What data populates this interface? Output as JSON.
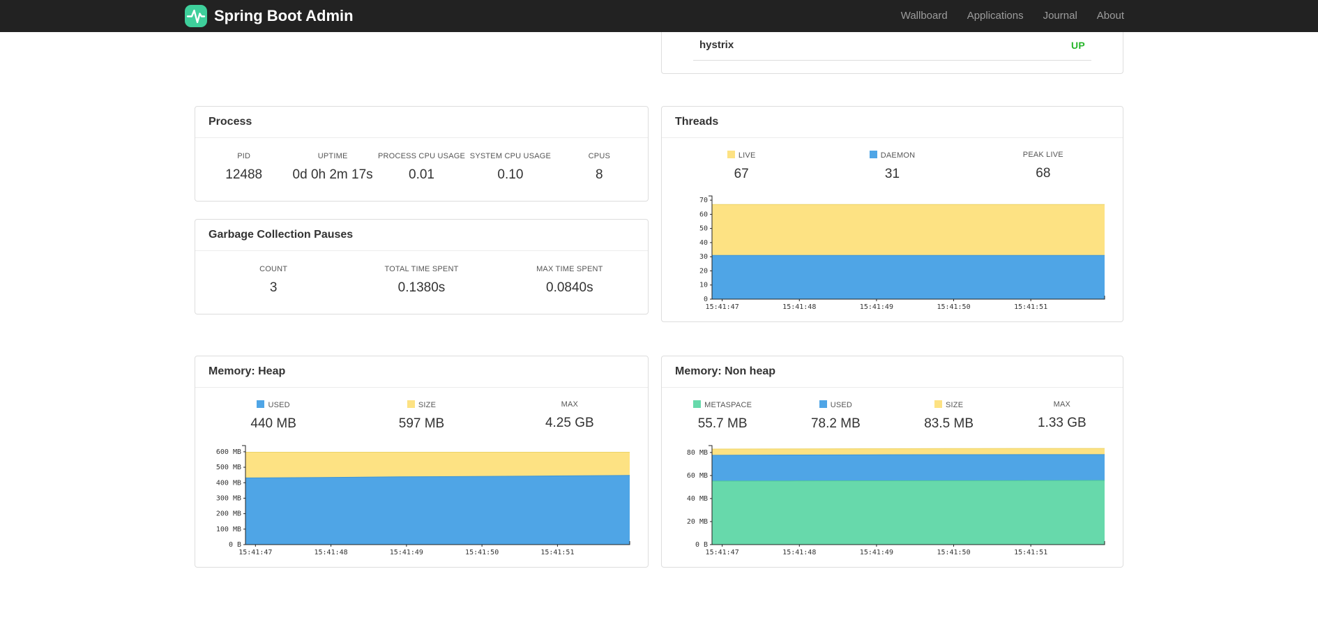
{
  "colors": {
    "brand_green": "#3ecf9b",
    "navbar_bg": "#222222",
    "up_green": "#28b62c",
    "chart_blue": "#4fa5e6",
    "chart_yellow": "#fde283",
    "chart_green": "#67d9ab"
  },
  "navbar": {
    "brand": "Spring Boot Admin",
    "links": [
      {
        "label": "Wallboard"
      },
      {
        "label": "Applications"
      },
      {
        "label": "Journal"
      },
      {
        "label": "About"
      }
    ]
  },
  "applications": {
    "app_name": "hystrix",
    "status": "UP",
    "status_color": "#28b62c"
  },
  "process": {
    "title": "Process",
    "stats": [
      {
        "label": "PID",
        "value": "12488",
        "color": null
      },
      {
        "label": "UPTIME",
        "value": "0d 0h 2m 17s",
        "color": null
      },
      {
        "label": "PROCESS CPU USAGE",
        "value": "0.01",
        "color": null
      },
      {
        "label": "SYSTEM CPU USAGE",
        "value": "0.10",
        "color": null
      },
      {
        "label": "CPUS",
        "value": "8",
        "color": null
      }
    ]
  },
  "gc": {
    "title": "Garbage Collection Pauses",
    "stats": [
      {
        "label": "COUNT",
        "value": "3",
        "color": null
      },
      {
        "label": "TOTAL TIME SPENT",
        "value": "0.1380s",
        "color": null
      },
      {
        "label": "MAX TIME SPENT",
        "value": "0.0840s",
        "color": null
      }
    ]
  },
  "threads": {
    "title": "Threads",
    "legend": [
      {
        "label": "LIVE",
        "value": "67",
        "color": "#fde283"
      },
      {
        "label": "DAEMON",
        "value": "31",
        "color": "#4fa5e6"
      },
      {
        "label": "PEAK LIVE",
        "value": "68",
        "color": null
      }
    ]
  },
  "heap": {
    "title": "Memory: Heap",
    "legend": [
      {
        "label": "USED",
        "value": "440 MB",
        "color": "#4fa5e6"
      },
      {
        "label": "SIZE",
        "value": "597 MB",
        "color": "#fde283"
      },
      {
        "label": "MAX",
        "value": "4.25 GB",
        "color": null
      }
    ]
  },
  "nonheap": {
    "title": "Memory: Non heap",
    "legend": [
      {
        "label": "METASPACE",
        "value": "55.7 MB",
        "color": "#67d9ab"
      },
      {
        "label": "USED",
        "value": "78.2 MB",
        "color": "#4fa5e6"
      },
      {
        "label": "SIZE",
        "value": "83.5 MB",
        "color": "#fde283"
      },
      {
        "label": "MAX",
        "value": "1.33 GB",
        "color": null
      }
    ]
  },
  "chart_data": [
    {
      "id": "chart-threads",
      "type": "area",
      "title": "Threads",
      "x_ticks": [
        "15:41:47",
        "15:41:48",
        "15:41:49",
        "15:41:50",
        "15:41:51"
      ],
      "y_ticks": [
        {
          "value": 0,
          "label": "0"
        },
        {
          "value": 10,
          "label": "10"
        },
        {
          "value": 20,
          "label": "20"
        },
        {
          "value": 30,
          "label": "30"
        },
        {
          "value": 40,
          "label": "40"
        },
        {
          "value": 50,
          "label": "50"
        },
        {
          "value": 60,
          "label": "60"
        },
        {
          "value": 70,
          "label": "70"
        }
      ],
      "y_plot_max": 73,
      "series": [
        {
          "name": "live",
          "color": "#fde283",
          "stroke": "#ecd468",
          "values": [
            67,
            67,
            67,
            67,
            67,
            67
          ]
        },
        {
          "name": "daemon",
          "color": "#4fa5e6",
          "stroke": "#3e95d6",
          "values": [
            31,
            31,
            31,
            31,
            31,
            31
          ]
        }
      ]
    },
    {
      "id": "chart-heap",
      "type": "area",
      "title": "Memory: Heap",
      "x_ticks": [
        "15:41:47",
        "15:41:48",
        "15:41:49",
        "15:41:50",
        "15:41:51"
      ],
      "y_ticks": [
        {
          "value": 0,
          "label": "0 B"
        },
        {
          "value": 100,
          "label": "100 MB"
        },
        {
          "value": 200,
          "label": "200 MB"
        },
        {
          "value": 300,
          "label": "300 MB"
        },
        {
          "value": 400,
          "label": "400 MB"
        },
        {
          "value": 500,
          "label": "500 MB"
        },
        {
          "value": 600,
          "label": "600 MB"
        }
      ],
      "y_plot_max": 640,
      "series": [
        {
          "name": "size",
          "color": "#fde283",
          "stroke": "#ecd468",
          "values": [
            597,
            597,
            597,
            597,
            597,
            597
          ]
        },
        {
          "name": "used",
          "color": "#4fa5e6",
          "stroke": "#3e95d6",
          "values": [
            431,
            434,
            438,
            441,
            444,
            447
          ]
        }
      ]
    },
    {
      "id": "chart-nonheap",
      "type": "area",
      "title": "Memory: Non heap",
      "x_ticks": [
        "15:41:47",
        "15:41:48",
        "15:41:49",
        "15:41:50",
        "15:41:51"
      ],
      "y_ticks": [
        {
          "value": 0,
          "label": "0 B"
        },
        {
          "value": 20,
          "label": "20 MB"
        },
        {
          "value": 40,
          "label": "40 MB"
        },
        {
          "value": 60,
          "label": "60 MB"
        },
        {
          "value": 80,
          "label": "80 MB"
        }
      ],
      "y_plot_max": 86,
      "series": [
        {
          "name": "size",
          "color": "#fde283",
          "stroke": "#ecd468",
          "values": [
            83.0,
            83.1,
            83.3,
            83.4,
            83.5,
            83.5
          ]
        },
        {
          "name": "used",
          "color": "#4fa5e6",
          "stroke": "#3e95d6",
          "values": [
            77.6,
            77.8,
            78.0,
            78.1,
            78.2,
            78.2
          ]
        },
        {
          "name": "metaspace",
          "color": "#67d9ab",
          "stroke": "#4ec79a",
          "values": [
            55.2,
            55.3,
            55.4,
            55.5,
            55.6,
            55.7
          ]
        }
      ]
    }
  ]
}
